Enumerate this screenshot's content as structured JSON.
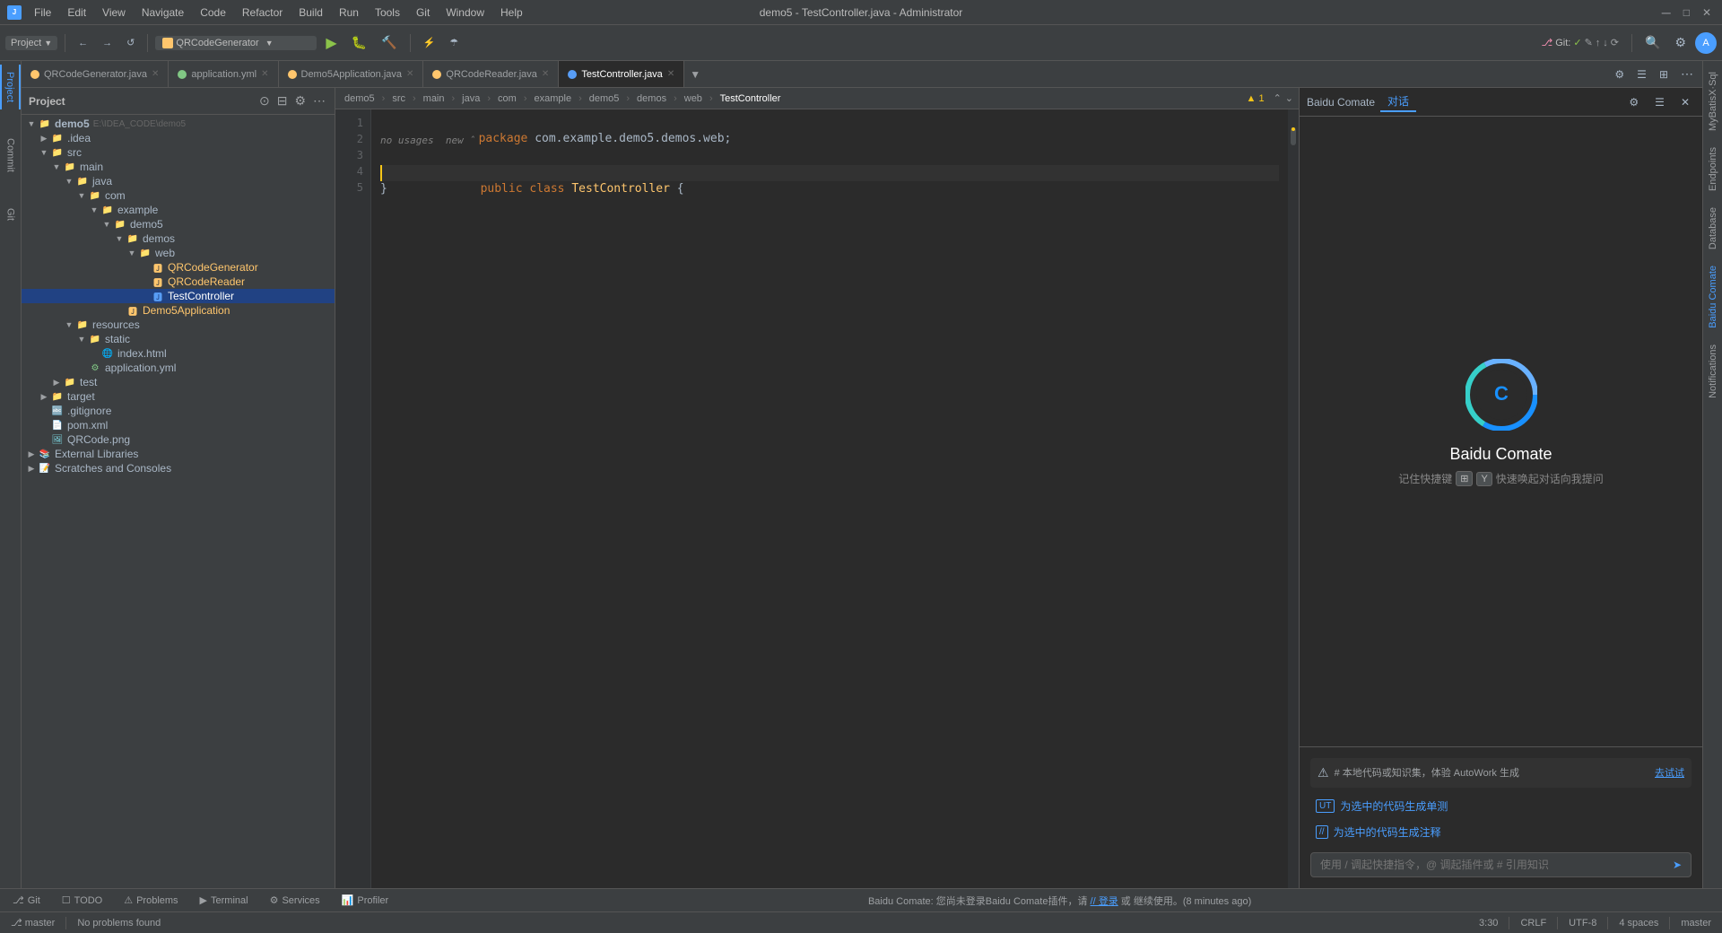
{
  "titlebar": {
    "title": "demo5 - TestController.java - Administrator",
    "menu": [
      "File",
      "Edit",
      "View",
      "Navigate",
      "Code",
      "Refactor",
      "Build",
      "Run",
      "Tools",
      "Git",
      "Window",
      "Help"
    ]
  },
  "toolbar": {
    "project_label": "Project",
    "run_config": "QRCodeGenerator",
    "git_label": "Git:",
    "git_status": "master"
  },
  "tabs": [
    {
      "label": "QRCodeGenerator.java",
      "color": "#ffc66d",
      "active": false
    },
    {
      "label": "application.yml",
      "color": "#81c784",
      "active": false
    },
    {
      "label": "Demo5Application.java",
      "color": "#ffc66d",
      "active": false
    },
    {
      "label": "QRCodeReader.java",
      "color": "#ffc66d",
      "active": false
    },
    {
      "label": "TestController.java",
      "color": "#ffc66d",
      "active": true
    }
  ],
  "breadcrumb": {
    "items": [
      "demo5",
      "src",
      "main",
      "java",
      "com",
      "example",
      "demo5",
      "demos",
      "web",
      "TestController"
    ]
  },
  "tree": {
    "root": "demo5",
    "root_path": "E:\\IDEA_CODE\\demo5",
    "items": [
      {
        "level": 0,
        "type": "dir",
        "label": ".idea",
        "expanded": false
      },
      {
        "level": 0,
        "type": "dir",
        "label": "src",
        "expanded": true
      },
      {
        "level": 1,
        "type": "dir",
        "label": "main",
        "expanded": true
      },
      {
        "level": 2,
        "type": "dir",
        "label": "java",
        "expanded": true
      },
      {
        "level": 3,
        "type": "dir",
        "label": "com",
        "expanded": true
      },
      {
        "level": 4,
        "type": "dir",
        "label": "example",
        "expanded": true
      },
      {
        "level": 5,
        "type": "dir",
        "label": "demo5",
        "expanded": true
      },
      {
        "level": 6,
        "type": "dir",
        "label": "demos",
        "expanded": true
      },
      {
        "level": 7,
        "type": "dir",
        "label": "web",
        "expanded": true
      },
      {
        "level": 8,
        "type": "java",
        "label": "QRCodeGenerator",
        "active": false
      },
      {
        "level": 8,
        "type": "java",
        "label": "QRCodeReader",
        "active": false
      },
      {
        "level": 8,
        "type": "java-ctrl",
        "label": "TestController",
        "active": true
      },
      {
        "level": 6,
        "type": "java",
        "label": "Demo5Application",
        "active": false
      },
      {
        "level": 1,
        "type": "dir",
        "label": "resources",
        "expanded": true
      },
      {
        "level": 2,
        "type": "dir",
        "label": "static",
        "expanded": true
      },
      {
        "level": 3,
        "type": "html",
        "label": "index.html",
        "active": false
      },
      {
        "level": 2,
        "type": "yaml",
        "label": "application.yml",
        "active": false
      },
      {
        "level": 0,
        "type": "dir",
        "label": "test",
        "expanded": false
      },
      {
        "level": 0,
        "type": "dir",
        "label": "target",
        "expanded": false
      },
      {
        "level": 0,
        "type": "git",
        "label": ".gitignore",
        "active": false
      },
      {
        "level": 0,
        "type": "xml",
        "label": "pom.xml",
        "active": false
      },
      {
        "level": 0,
        "type": "png",
        "label": "QRCode.png",
        "active": false
      },
      {
        "level": 0,
        "type": "dir",
        "label": "External Libraries",
        "expanded": false
      },
      {
        "level": 0,
        "type": "dir",
        "label": "Scratches and Consoles",
        "expanded": false
      }
    ]
  },
  "editor": {
    "filename": "TestController.java",
    "warning": "▲ 1",
    "lines": [
      {
        "num": 1,
        "content": "package com.example.demo5.demos.web;",
        "class": ""
      },
      {
        "num": 2,
        "content": "",
        "class": ""
      },
      {
        "num": 3,
        "content": "public class TestController {",
        "class": ""
      },
      {
        "num": 4,
        "content": "}",
        "class": ""
      },
      {
        "num": 5,
        "content": "",
        "class": ""
      }
    ],
    "hint_line": "no usages  new ˆ"
  },
  "right_panel": {
    "title": "Baidu Comate",
    "tab_label": "对话",
    "logo_text": "C",
    "main_title": "Baidu Comate",
    "hint": "记住快捷键",
    "shortcut_win": "⌘",
    "shortcut_y": "Y",
    "hint2": "快速唤起对话向我提问",
    "notice": {
      "icon": "⚠",
      "text": "# 本地代码或知识集，体验 AutoWork 生成",
      "link": "去试试"
    },
    "actions": [
      {
        "icon": "UT",
        "label": "为选中的代码生成单测"
      },
      {
        "icon": "//",
        "label": "为选中的代码生成注释"
      }
    ],
    "input_placeholder": "使用 / 调起快捷指令，@ 调起插件或 # 引用知识"
  },
  "right_tools": {
    "items": [
      "MyBatisX·Sql",
      "Endpoints",
      "Database",
      "Baidu Comate",
      "Notifications"
    ]
  },
  "left_tools": {
    "items": [
      "Project",
      "Commit",
      "Git"
    ]
  },
  "bottom_tabs": [
    {
      "label": "Git",
      "icon": "⎇"
    },
    {
      "label": "TODO",
      "icon": ""
    },
    {
      "label": "Problems",
      "icon": ""
    },
    {
      "label": "Terminal",
      "icon": ""
    },
    {
      "label": "Services",
      "icon": ""
    },
    {
      "label": "Profiler",
      "icon": ""
    }
  ],
  "notice_bar": {
    "text": "Baidu Comate: 您尚未登录Baidu Comate插件，请 // 登录 或 继续使用。(8 minutes ago)"
  },
  "status_bar": {
    "time": "3:30",
    "line_ending": "CRLF",
    "encoding": "UTF-8",
    "indent": "4 spaces",
    "branch": "master"
  }
}
